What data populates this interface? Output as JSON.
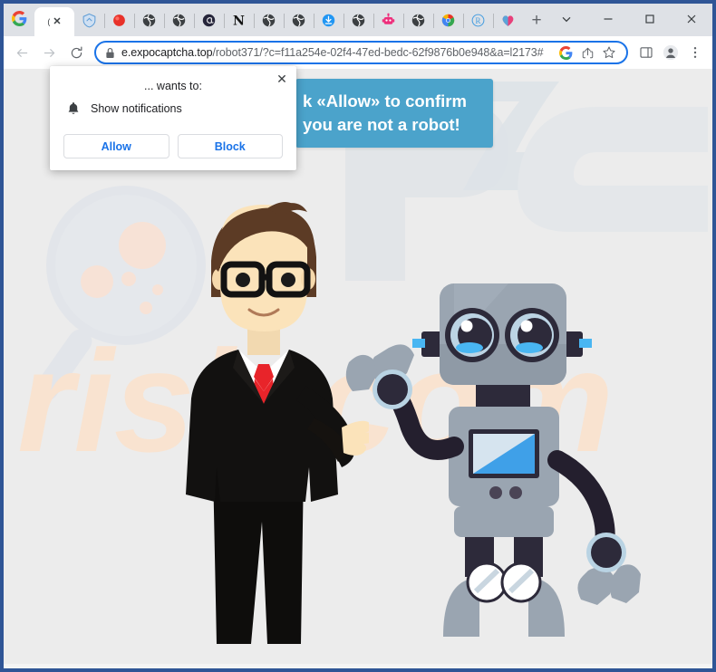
{
  "window": {
    "controls": {
      "chevron_down": "chevron-down",
      "minimize": "minimize",
      "maximize": "maximize",
      "close": "close"
    }
  },
  "tabstrip": {
    "leading_icon": "google-icon",
    "active_tab": {
      "title": "(",
      "close_label": "✕"
    },
    "pinned_tabs": [
      {
        "name": "pinned-tab-shield",
        "icon": "shield-icon",
        "color": "#4f8ed6"
      },
      {
        "name": "pinned-tab-red-dot",
        "icon": "red-circle-icon",
        "color": "#e8322a"
      },
      {
        "name": "pinned-tab-globe-1",
        "icon": "globe-icon",
        "color": "#3c4043"
      },
      {
        "name": "pinned-tab-globe-2",
        "icon": "globe-icon",
        "color": "#3c4043"
      },
      {
        "name": "pinned-tab-at",
        "icon": "at-sign-icon",
        "color": "#2a2a3a"
      },
      {
        "name": "pinned-tab-n",
        "icon": "letter-n-icon",
        "color": "#1a1a1a"
      },
      {
        "name": "pinned-tab-globe-3",
        "icon": "globe-icon",
        "color": "#3c4043"
      },
      {
        "name": "pinned-tab-globe-4",
        "icon": "globe-icon",
        "color": "#3c4043"
      },
      {
        "name": "pinned-tab-download",
        "icon": "download-circle-icon",
        "color": "#2196f3"
      },
      {
        "name": "pinned-tab-globe-5",
        "icon": "globe-icon",
        "color": "#3c4043"
      },
      {
        "name": "pinned-tab-robot",
        "icon": "robot-icon",
        "color": "#ee2e7b"
      },
      {
        "name": "pinned-tab-globe-6",
        "icon": "globe-icon",
        "color": "#3c4043"
      },
      {
        "name": "pinned-tab-chrome",
        "icon": "chrome-icon",
        "color": "#4caf50"
      },
      {
        "name": "pinned-tab-r",
        "icon": "letter-r-icon",
        "color": "#4a9fe0"
      },
      {
        "name": "pinned-tab-heart",
        "icon": "heart-icon",
        "color": "#e8407a"
      }
    ],
    "new_tab_label": "+"
  },
  "toolbar": {
    "back_label": "back",
    "forward_label": "forward",
    "reload_label": "reload",
    "url": {
      "host": "e.expocaptcha.top",
      "path": "/robot371/?c=f11a254e-02f4-47ed-bedc-62f9876b0e948&a=l2173#",
      "full": "e.expocaptcha.top/robot371/?c=f11a254e-02f4-47ed-bedc-62f9876b0e948&a=l2173#"
    },
    "lock_icon": "lock-icon",
    "google_icon": "google-icon",
    "share_icon": "share-icon",
    "bookmark_icon": "star-icon",
    "sidepanel_icon": "side-panel-icon",
    "profile_icon": "profile-avatar-icon",
    "menu_icon": "three-dot-menu-icon"
  },
  "page": {
    "background_color": "#ececec",
    "banner": {
      "background_color": "#4ba3cb",
      "line1": "k «Allow» to confirm",
      "line2": "you are not a robot!"
    },
    "watermarks": {
      "magnifier": "magnifying-glass-watermark",
      "pc_logo": "pc-logo-watermark",
      "risk_text": "risk.com",
      "risk_color": "#f6e2cf"
    },
    "illustration": {
      "man": "businessman-with-glasses",
      "robot": "waving-robot"
    }
  },
  "notification_popup": {
    "title": "... wants to:",
    "permission_label": "Show notifications",
    "permission_icon": "bell-icon",
    "close_label": "✕",
    "allow_label": "Allow",
    "block_label": "Block",
    "accent_color": "#1a73e8"
  }
}
